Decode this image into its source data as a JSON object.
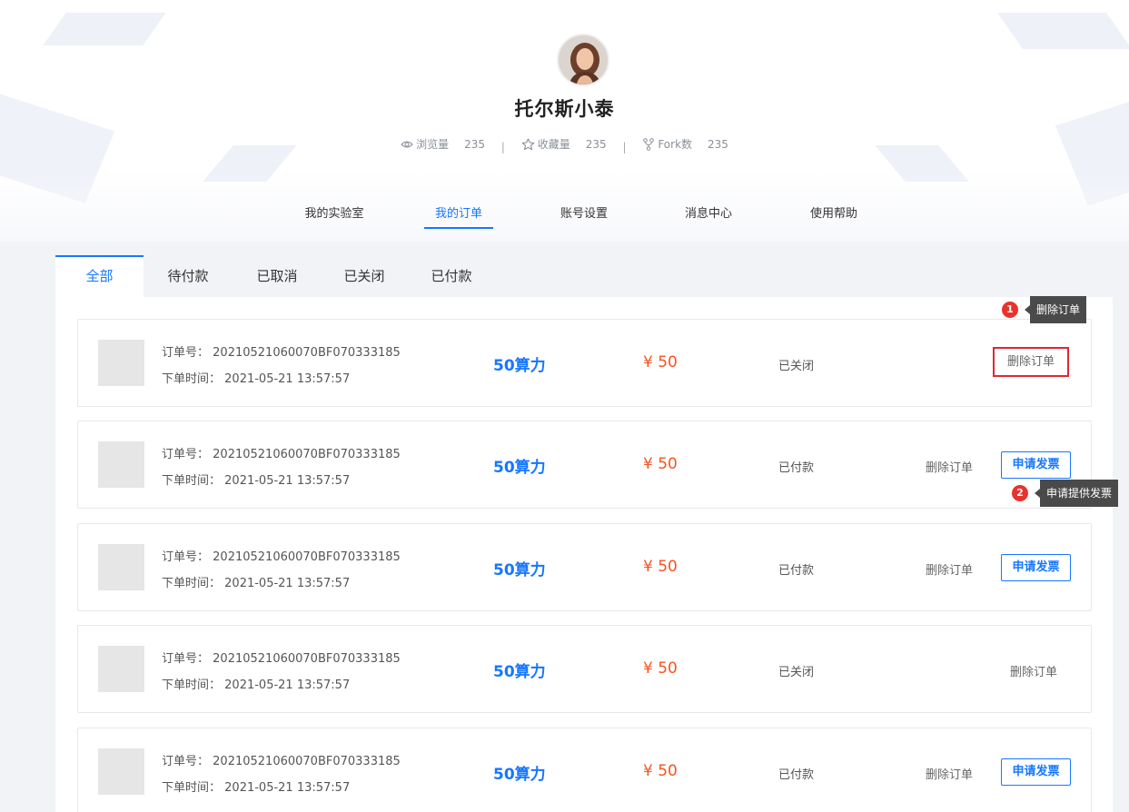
{
  "profile": {
    "name": "托尔斯小泰",
    "views_label": "浏览量",
    "views": "235",
    "favorites_label": "收藏量",
    "favorites": "235",
    "forks_label": "Fork数",
    "forks": "235",
    "separator": "|"
  },
  "nav": {
    "items": [
      {
        "label": "我的实验室"
      },
      {
        "label": "我的订单"
      },
      {
        "label": "账号设置"
      },
      {
        "label": "消息中心"
      },
      {
        "label": "使用帮助"
      }
    ],
    "active": "我的订单"
  },
  "tabs": {
    "items": [
      {
        "label": "全部"
      },
      {
        "label": "待付款"
      },
      {
        "label": "已取消"
      },
      {
        "label": "已关闭"
      },
      {
        "label": "已付款"
      }
    ],
    "active": "全部"
  },
  "order_labels": {
    "order_no": "订单号：",
    "order_time": "下单时间：",
    "delete": "删除订单",
    "invoice": "申请发票"
  },
  "orders": [
    {
      "order_no": "20210521060070BF070333185",
      "time": "2021-05-21 13:57:57",
      "power": "50算力",
      "price": "¥ 50",
      "status": "已关闭"
    },
    {
      "order_no": "20210521060070BF070333185",
      "time": "2021-05-21 13:57:57",
      "power": "50算力",
      "price": "¥ 50",
      "status": "已付款"
    },
    {
      "order_no": "20210521060070BF070333185",
      "time": "2021-05-21 13:57:57",
      "power": "50算力",
      "price": "¥ 50",
      "status": "已付款"
    },
    {
      "order_no": "20210521060070BF070333185",
      "time": "2021-05-21 13:57:57",
      "power": "50算力",
      "price": "¥ 50",
      "status": "已关闭"
    },
    {
      "order_no": "20210521060070BF070333185",
      "time": "2021-05-21 13:57:57",
      "power": "50算力",
      "price": "¥ 50",
      "status": "已付款"
    }
  ],
  "annotations": [
    {
      "number": "1",
      "text": "删除订单"
    },
    {
      "number": "2",
      "text": "申请提供发票"
    }
  ],
  "colors": {
    "accent": "#1677ff",
    "price": "#f5541f",
    "highlight": "#e0272f",
    "tooltip": "#4a4a4a"
  }
}
